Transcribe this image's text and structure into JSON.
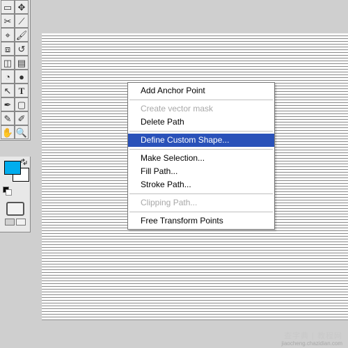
{
  "tools": [
    {
      "name": "rect-marquee",
      "glyph": "▭"
    },
    {
      "name": "move",
      "glyph": "✥"
    },
    {
      "name": "crop",
      "glyph": "✂"
    },
    {
      "name": "slice",
      "glyph": "⟋"
    },
    {
      "name": "healing",
      "glyph": "⌖"
    },
    {
      "name": "brush",
      "glyph": "🖌"
    },
    {
      "name": "clone",
      "glyph": "⧈"
    },
    {
      "name": "history",
      "glyph": "↺"
    },
    {
      "name": "eraser",
      "glyph": "◫"
    },
    {
      "name": "gradient",
      "glyph": "▤"
    },
    {
      "name": "blur",
      "glyph": "◔"
    },
    {
      "name": "dodge",
      "glyph": "●"
    },
    {
      "name": "path",
      "glyph": "↖"
    },
    {
      "name": "type",
      "glyph": "T"
    },
    {
      "name": "pen",
      "glyph": "✒"
    },
    {
      "name": "rect",
      "glyph": "▢"
    },
    {
      "name": "notes",
      "glyph": "✎"
    },
    {
      "name": "eyedrop",
      "glyph": "✐"
    },
    {
      "name": "hand",
      "glyph": "✋"
    },
    {
      "name": "zoom",
      "glyph": "🔍"
    }
  ],
  "colors": {
    "fg": "#00adee",
    "bg": "#ffffff"
  },
  "menu": {
    "items": [
      {
        "label": "Add Anchor Point",
        "state": "normal"
      },
      {
        "label": "Create vector mask",
        "state": "disabled"
      },
      {
        "label": "Delete Path",
        "state": "normal"
      },
      {
        "label": "Define Custom Shape...",
        "state": "highlighted"
      },
      {
        "label": "Make Selection...",
        "state": "normal"
      },
      {
        "label": "Fill Path...",
        "state": "normal"
      },
      {
        "label": "Stroke Path...",
        "state": "normal"
      },
      {
        "label": "Clipping Path...",
        "state": "disabled"
      },
      {
        "label": "Free Transform Points",
        "state": "normal"
      }
    ]
  },
  "watermark": "查字典 | 教程网",
  "watermark2": "jiaocheng.chazidian.com"
}
